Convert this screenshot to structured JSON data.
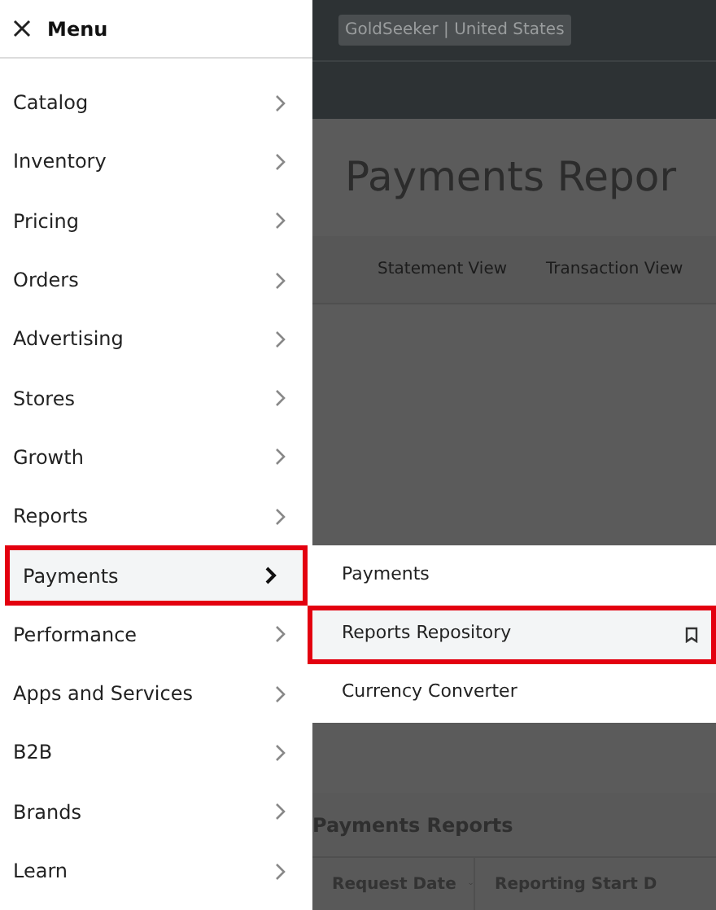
{
  "menu": {
    "title": "Menu",
    "items": [
      {
        "label": "Catalog",
        "selected": false,
        "highlighted": false
      },
      {
        "label": "Inventory",
        "selected": false,
        "highlighted": false
      },
      {
        "label": "Pricing",
        "selected": false,
        "highlighted": false
      },
      {
        "label": "Orders",
        "selected": false,
        "highlighted": false
      },
      {
        "label": "Advertising",
        "selected": false,
        "highlighted": false
      },
      {
        "label": "Stores",
        "selected": false,
        "highlighted": false
      },
      {
        "label": "Growth",
        "selected": false,
        "highlighted": false
      },
      {
        "label": "Reports",
        "selected": false,
        "highlighted": false
      },
      {
        "label": "Payments",
        "selected": true,
        "highlighted": true
      },
      {
        "label": "Performance",
        "selected": false,
        "highlighted": false
      },
      {
        "label": "Apps and Services",
        "selected": false,
        "highlighted": false
      },
      {
        "label": "B2B",
        "selected": false,
        "highlighted": false
      },
      {
        "label": "Brands",
        "selected": false,
        "highlighted": false
      },
      {
        "label": "Learn",
        "selected": false,
        "highlighted": false
      }
    ]
  },
  "submenu": {
    "items": [
      {
        "label": "Payments",
        "selected": false,
        "highlighted": false,
        "bookmark": false
      },
      {
        "label": "Reports Repository",
        "selected": true,
        "highlighted": true,
        "bookmark": true
      },
      {
        "label": "Currency Converter",
        "selected": false,
        "highlighted": false,
        "bookmark": false
      }
    ]
  },
  "header": {
    "account": "GoldSeeker | United States"
  },
  "page": {
    "title": "Payments Repor",
    "tabs": [
      "Statement View",
      "Transaction View"
    ],
    "section_title": "Payments Reports",
    "columns": [
      "Request Date",
      "Reporting Start D"
    ]
  }
}
